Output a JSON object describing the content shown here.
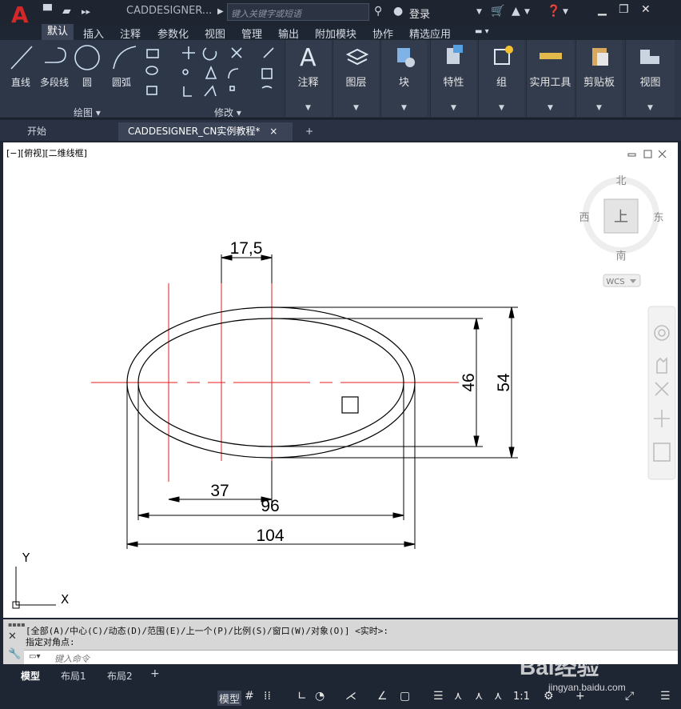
{
  "app": {
    "logo_letter": "A",
    "document_title": "CADDESIGNER...",
    "search_placeholder": "键入关键字或短语",
    "login_label": "登录"
  },
  "menu_tabs": [
    "默认",
    "插入",
    "注释",
    "参数化",
    "视图",
    "管理",
    "输出",
    "附加模块",
    "协作",
    "精选应用"
  ],
  "ribbon": {
    "draw_tools": {
      "line": "直线",
      "polyline": "多段线",
      "circle": "圆",
      "arc": "圆弧"
    },
    "panel_titles": {
      "draw": "绘图",
      "modify": "修改"
    },
    "panels": [
      "注释",
      "图层",
      "块",
      "特性",
      "组",
      "实用工具",
      "剪贴板",
      "视图"
    ]
  },
  "doc_tabs": {
    "start": "开始",
    "active": "CADDESIGNER_CN实例教程*",
    "close": "×",
    "add": "+"
  },
  "viewport": {
    "label": "[−][俯视][二维线框]",
    "viewcube": {
      "north": "北",
      "south": "南",
      "east": "东",
      "west": "西",
      "top": "上",
      "wcs": "WCS"
    },
    "ucs": {
      "x": "X",
      "y": "Y"
    }
  },
  "drawing": {
    "dimensions": {
      "d1": "17,5",
      "d2": "37",
      "d3": "96",
      "d4": "104",
      "d5": "46",
      "d6": "54"
    },
    "colors": {
      "centerline": "#e81c1c",
      "geometry": "#000000"
    }
  },
  "command_line": {
    "history_1": "[全部(A)/中心(C)/动态(D)/范围(E)/上一个(P)/比例(S)/窗口(W)/对象(O)] <实时>:",
    "history_2": "指定对角点:",
    "placeholder": "键入命令"
  },
  "layout_tabs": [
    "模型",
    "布局1",
    "布局2"
  ],
  "status_bar": {
    "model_label": "模型",
    "scale": "1:1"
  },
  "watermark": {
    "text": "Bai经验",
    "url": "jingyan.baidu.com"
  }
}
